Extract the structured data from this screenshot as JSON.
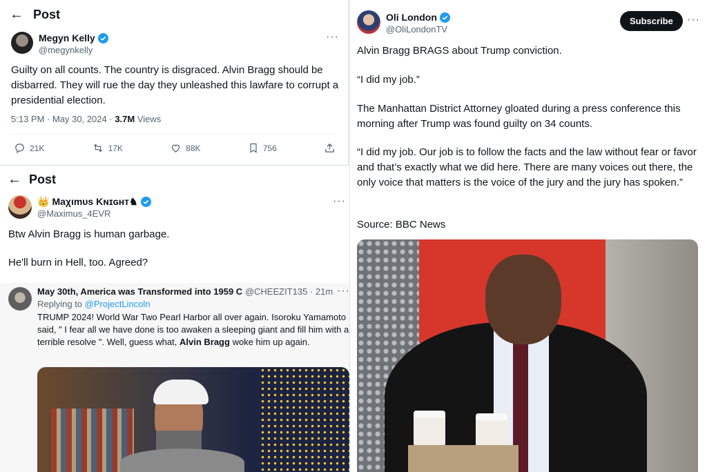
{
  "post1": {
    "header": "Post",
    "name": "Megyn Kelly",
    "handle": "@megynkelly",
    "text": "Guilty on all counts. The country is disgraced. Alvin Bragg should be disbarred. They will rue the day they unleashed this lawfare to corrupt a presidential election.",
    "time": "5:13 PM · May 30, 2024 ·",
    "views_count": "3.7M",
    "views_label": "Views",
    "replies": "21K",
    "reposts": "17K",
    "likes": "88K",
    "bookmarks": "756"
  },
  "post2": {
    "header": "Post",
    "name": "Maχιmυs Kɴɪɢʜᴛ♞",
    "handle": "@Maximus_4EVR",
    "line1": "Btw Alvin Bragg is human garbage.",
    "line2": "He'll burn in Hell, too. Agreed?"
  },
  "post3": {
    "name": "May 30th, America was Transformed into 1959 C",
    "handle": "@CHEEZIT135 · 21m",
    "reply_prefix": "Replying to",
    "reply_to": "@ProjectLincoln",
    "text_a": "TRUMP 2024!  World War Two Pearl Harbor all over again.   Isoroku Yamamoto said, \" I fear all we have done is too awaken a sleeping giant and fill him with a terrible resolve \". Well, guess what,",
    "text_bold": "Alvin Bragg",
    "text_b": "woke him up again."
  },
  "post4": {
    "name": "Oli London",
    "handle": "@OliLondonTV",
    "subscribe": "Subscribe",
    "p1": "Alvin Bragg BRAGS about Trump conviction.",
    "p2": "“I did my job.”",
    "p3": "The Manhattan District Attorney gloated during a press conference this morning after Trump was found guilty on 34 counts.",
    "p4": "“I did my job. Our job is to follow the facts and the law without fear or favor and that’s exactly what we did here. There are many voices out there, the only voice that matters is the voice of the jury and the jury has spoken.”",
    "p5": "Source: BBC News"
  },
  "colors": {
    "accent": "#1d9bf0",
    "text": "#0f1419",
    "muted": "#536471"
  }
}
